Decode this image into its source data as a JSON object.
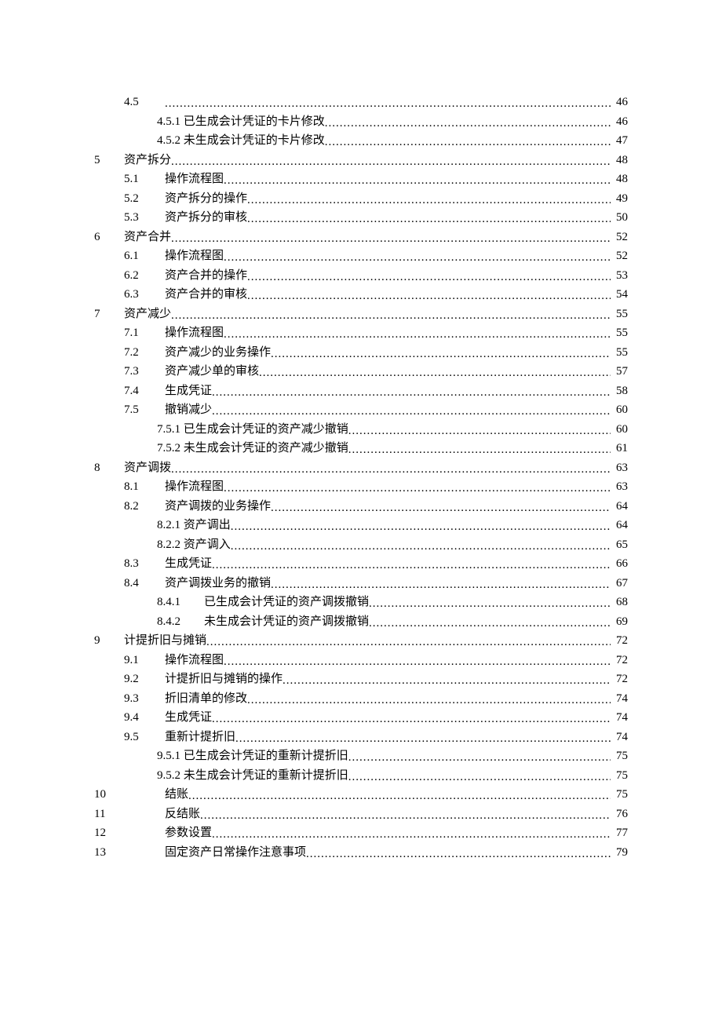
{
  "toc": [
    {
      "level": 1,
      "num": "4.5",
      "title": "",
      "page": "46"
    },
    {
      "level": 2,
      "num": "",
      "title": "4.5.1 已生成会计凭证的卡片修改",
      "page": "46"
    },
    {
      "level": 2,
      "num": "",
      "title": "4.5.2 未生成会计凭证的卡片修改",
      "page": "47"
    },
    {
      "level": 0,
      "num": "5",
      "title": "资产拆分",
      "page": "48"
    },
    {
      "level": 1,
      "num": "5.1",
      "title": "操作流程图",
      "page": "48"
    },
    {
      "level": 1,
      "num": "5.2",
      "title": "资产拆分的操作",
      "page": "49"
    },
    {
      "level": 1,
      "num": "5.3",
      "title": "资产拆分的审核",
      "page": "50"
    },
    {
      "level": 0,
      "num": "6",
      "title": "资产合并",
      "page": "52"
    },
    {
      "level": 1,
      "num": "6.1",
      "title": "操作流程图",
      "page": "52"
    },
    {
      "level": 1,
      "num": "6.2",
      "title": "资产合并的操作",
      "page": "53"
    },
    {
      "level": 1,
      "num": "6.3",
      "title": "资产合并的审核",
      "page": "54"
    },
    {
      "level": 0,
      "num": "7",
      "title": "资产减少",
      "page": "55"
    },
    {
      "level": 1,
      "num": "7.1",
      "title": "操作流程图",
      "page": "55"
    },
    {
      "level": 1,
      "num": "7.2",
      "title": "资产减少的业务操作",
      "page": "55"
    },
    {
      "level": 1,
      "num": "7.3",
      "title": "资产减少单的审核",
      "page": "57"
    },
    {
      "level": 1,
      "num": "7.4",
      "title": "生成凭证",
      "page": "58"
    },
    {
      "level": 1,
      "num": "7.5",
      "title": "撤销减少",
      "page": "60"
    },
    {
      "level": 2,
      "num": "",
      "title": "7.5.1 已生成会计凭证的资产减少撤销",
      "page": "60"
    },
    {
      "level": 2,
      "num": "",
      "title": "7.5.2 未生成会计凭证的资产减少撤销",
      "page": "61"
    },
    {
      "level": 0,
      "num": "8",
      "title": "资产调拨",
      "page": "63"
    },
    {
      "level": 1,
      "num": "8.1",
      "title": "操作流程图",
      "page": "63"
    },
    {
      "level": 1,
      "num": "8.2",
      "title": "资产调拨的业务操作",
      "page": "64"
    },
    {
      "level": 2,
      "num": "",
      "title": "8.2.1 资产调出",
      "page": "64"
    },
    {
      "level": 2,
      "num": "",
      "title": "8.2.2 资产调入",
      "page": "65"
    },
    {
      "level": 1,
      "num": "8.3",
      "title": "生成凭证",
      "page": "66"
    },
    {
      "level": 1,
      "num": "8.4",
      "title": "资产调拨业务的撤销",
      "page": "67"
    },
    {
      "level": "2b",
      "num": "8.4.1",
      "title": "已生成会计凭证的资产调拨撤销",
      "page": "68"
    },
    {
      "level": "2b",
      "num": "8.4.2",
      "title": "未生成会计凭证的资产调拨撤销",
      "page": "69"
    },
    {
      "level": 0,
      "num": "9",
      "title": "计提折旧与摊销",
      "page": "72"
    },
    {
      "level": 1,
      "num": "9.1",
      "title": "操作流程图",
      "page": "72"
    },
    {
      "level": 1,
      "num": "9.2",
      "title": "计提折旧与摊销的操作",
      "page": "72"
    },
    {
      "level": 1,
      "num": "9.3",
      "title": "折旧清单的修改",
      "page": "74"
    },
    {
      "level": 1,
      "num": "9.4",
      "title": "生成凭证",
      "page": "74"
    },
    {
      "level": 1,
      "num": "9.5",
      "title": "重新计提折旧",
      "page": "74"
    },
    {
      "level": 2,
      "num": "",
      "title": "9.5.1 已生成会计凭证的重新计提折旧",
      "page": "75"
    },
    {
      "level": 2,
      "num": "",
      "title": "9.5.2 未生成会计凭证的重新计提折旧",
      "page": "75"
    },
    {
      "level": 0,
      "num": "10",
      "title": "结账",
      "page": "75"
    },
    {
      "level": 0,
      "num": "11",
      "title": "反结账",
      "page": "76"
    },
    {
      "level": 0,
      "num": "12",
      "title": "参数设置",
      "page": "77"
    },
    {
      "level": 0,
      "num": "13",
      "title": "固定资产日常操作注意事项",
      "page": "79"
    }
  ]
}
